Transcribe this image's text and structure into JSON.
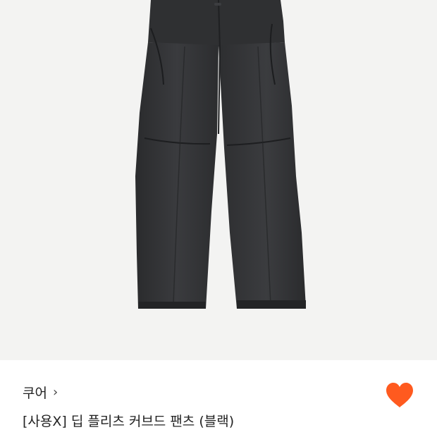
{
  "product": {
    "brand": "쿠어",
    "brand_chevron": "›",
    "title": "[사용X] 딥 플리츠 커브드 팬츠 (블랙)",
    "image_background": "#f3f3f2",
    "image_subject": "black curved denim pants"
  },
  "like": {
    "icon": "heart-icon",
    "color": "#ff5a1f"
  }
}
